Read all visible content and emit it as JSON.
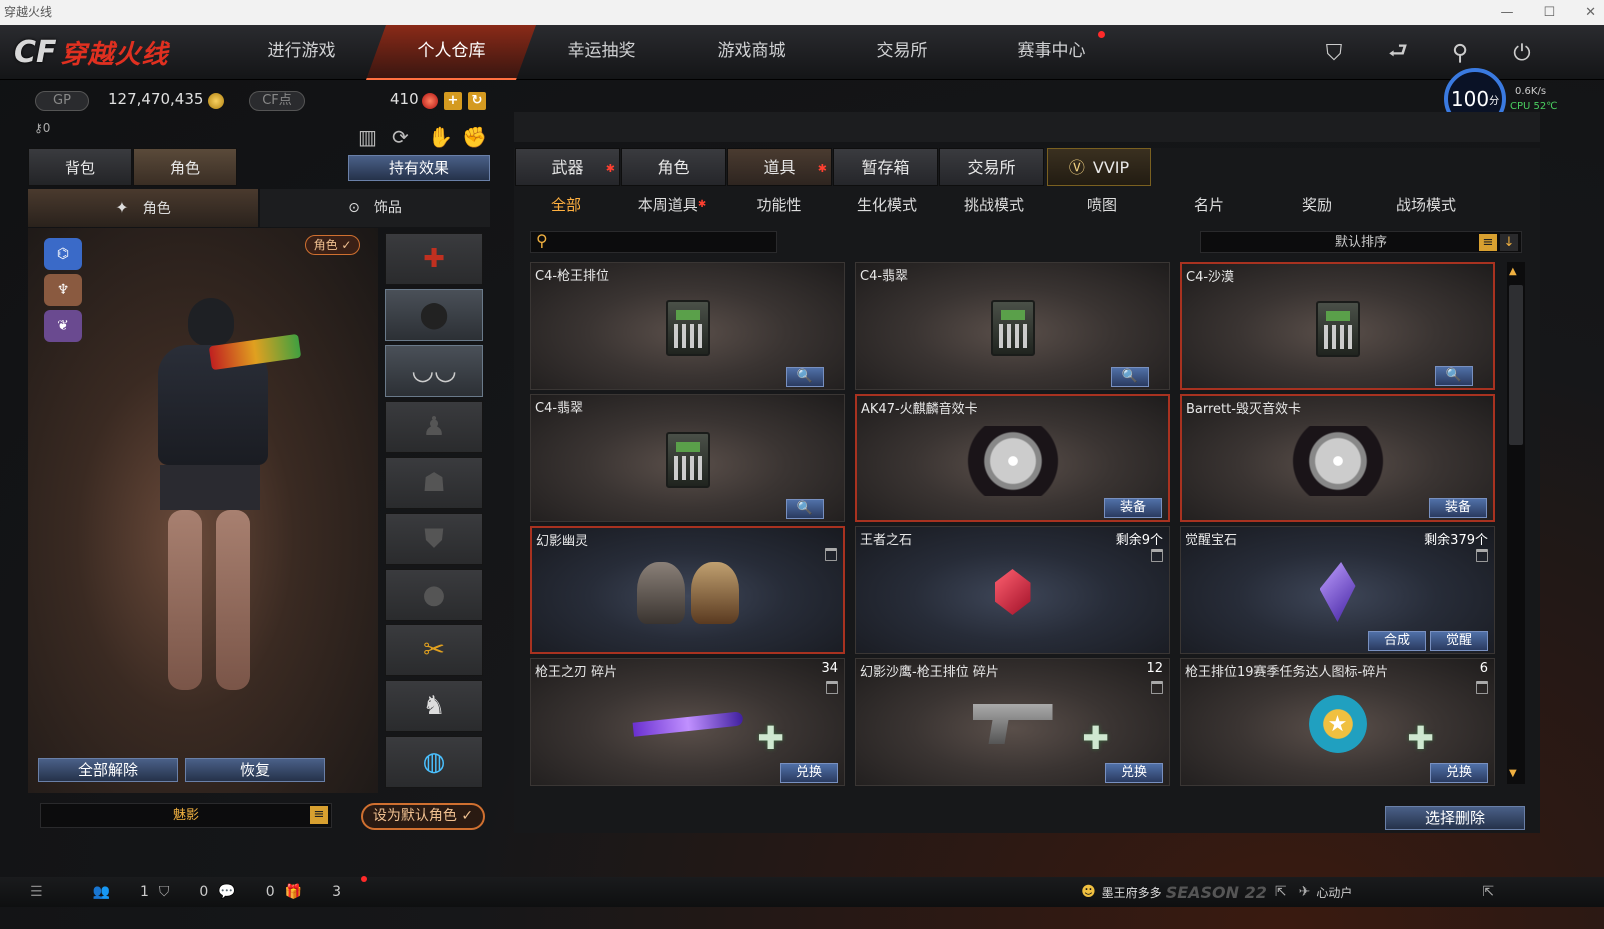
{
  "window": {
    "title": "穿越火线",
    "controls": [
      "—",
      "☐",
      "✕"
    ]
  },
  "logo": {
    "cf": "CF",
    "cn": "穿越火线"
  },
  "nav": {
    "tabs": [
      "进行游戏",
      "个人仓库",
      "幸运抽奖",
      "游戏商城",
      "交易所",
      "赛事中心"
    ],
    "active": "个人仓库"
  },
  "currency": {
    "gp_label": "GP",
    "gp_value": "127,470,435",
    "cf_label": "CF点",
    "cf_value": "410",
    "key_count": "0"
  },
  "perf": {
    "fps": "100",
    "fps_unit": "分",
    "net": "0.6K/s",
    "cpu": "CPU 52℃"
  },
  "left": {
    "tabs": [
      "背包",
      "角色"
    ],
    "effect_button": "持有效果",
    "subtabs": [
      "角色",
      "饰品"
    ],
    "role_badge": "角色 ✓",
    "unequip_all": "全部解除",
    "restore": "恢复",
    "char_name": "魅影",
    "set_default": "设为默认角色 ✓"
  },
  "categories": [
    "武器",
    "角色",
    "道具",
    "暂存箱",
    "交易所",
    "VVIP"
  ],
  "active_category": "道具",
  "filters": [
    "全部",
    "本周道具",
    "功能性",
    "生化模式",
    "挑战模式",
    "喷图",
    "名片",
    "奖励",
    "战场模式"
  ],
  "active_filter": "全部",
  "sort": {
    "label": "默认排序"
  },
  "items": [
    {
      "name": "C4-枪王排位",
      "count": "",
      "kind": "c4",
      "buttons": [
        "🔍"
      ]
    },
    {
      "name": "C4-翡翠",
      "count": "",
      "kind": "c4",
      "buttons": [
        "🔍"
      ]
    },
    {
      "name": "C4-沙漠",
      "count": "",
      "kind": "c4",
      "buttons": [
        "🔍"
      ]
    },
    {
      "name": "C4-翡翠",
      "count": "",
      "kind": "c4",
      "buttons": [
        "🔍"
      ]
    },
    {
      "name": "AK47-火麒麟音效卡",
      "count": "",
      "kind": "disc",
      "buttons": [
        "装备"
      ]
    },
    {
      "name": "Barrett-毁灭音效卡",
      "count": "",
      "kind": "disc",
      "buttons": [
        "装备"
      ]
    },
    {
      "name": "幻影幽灵",
      "count": "",
      "kind": "ghost",
      "buttons": []
    },
    {
      "name": "王者之石",
      "count": "剩余9个",
      "kind": "gem",
      "buttons": []
    },
    {
      "name": "觉醒宝石",
      "count": "剩余379个",
      "kind": "gem2",
      "buttons": [
        "合成",
        "觉醒"
      ]
    },
    {
      "name": "枪王之刃 碎片",
      "count": "34",
      "kind": "blade",
      "buttons": [
        "兑换"
      ]
    },
    {
      "name": "幻影沙鹰-枪王排位 碎片",
      "count": "12",
      "kind": "pistol",
      "buttons": [
        "兑换"
      ]
    },
    {
      "name": "枪王排位19赛季任务达人图标-碎片",
      "count": "6",
      "kind": "badge",
      "buttons": [
        "兑换"
      ]
    }
  ],
  "select_delete": "选择删除",
  "bottom": {
    "friends": "1",
    "clan": "0",
    "chat": "0",
    "gifts": "3",
    "player": "墨王府多多",
    "season": "SEASON 22",
    "vip": "心动户"
  },
  "colors": {
    "accent": "#ff7040",
    "active_filter": "#ffb040",
    "button_blue": "#2a3a60",
    "card_red_border": "#a83220"
  }
}
